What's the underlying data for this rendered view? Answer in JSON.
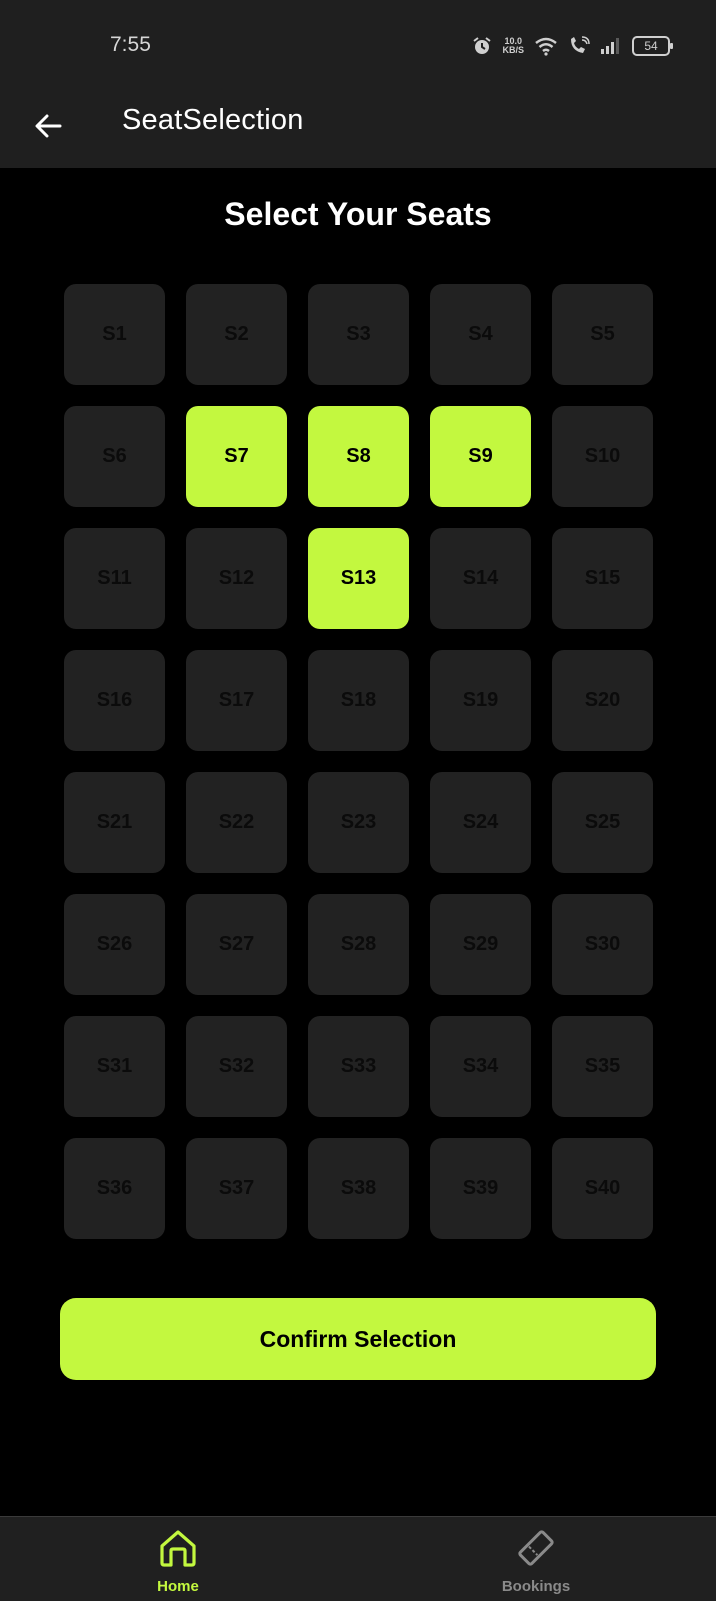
{
  "status_bar": {
    "time": "7:55",
    "net_speed_value": "10.0",
    "net_speed_unit": "KB/S",
    "battery": "54",
    "icons": [
      "alarm-icon",
      "wifi-icon",
      "wifi-call-icon",
      "signal-icon",
      "battery-icon"
    ]
  },
  "app_bar": {
    "title": "SeatSelection",
    "back_icon": "arrow-left-icon"
  },
  "main": {
    "heading": "Select Your Seats",
    "seats": [
      {
        "label": "S1",
        "selected": false
      },
      {
        "label": "S2",
        "selected": false
      },
      {
        "label": "S3",
        "selected": false
      },
      {
        "label": "S4",
        "selected": false
      },
      {
        "label": "S5",
        "selected": false
      },
      {
        "label": "S6",
        "selected": false
      },
      {
        "label": "S7",
        "selected": true
      },
      {
        "label": "S8",
        "selected": true
      },
      {
        "label": "S9",
        "selected": true
      },
      {
        "label": "S10",
        "selected": false
      },
      {
        "label": "S11",
        "selected": false
      },
      {
        "label": "S12",
        "selected": false
      },
      {
        "label": "S13",
        "selected": true
      },
      {
        "label": "S14",
        "selected": false
      },
      {
        "label": "S15",
        "selected": false
      },
      {
        "label": "S16",
        "selected": false
      },
      {
        "label": "S17",
        "selected": false
      },
      {
        "label": "S18",
        "selected": false
      },
      {
        "label": "S19",
        "selected": false
      },
      {
        "label": "S20",
        "selected": false
      },
      {
        "label": "S21",
        "selected": false
      },
      {
        "label": "S22",
        "selected": false
      },
      {
        "label": "S23",
        "selected": false
      },
      {
        "label": "S24",
        "selected": false
      },
      {
        "label": "S25",
        "selected": false
      },
      {
        "label": "S26",
        "selected": false
      },
      {
        "label": "S27",
        "selected": false
      },
      {
        "label": "S28",
        "selected": false
      },
      {
        "label": "S29",
        "selected": false
      },
      {
        "label": "S30",
        "selected": false
      },
      {
        "label": "S31",
        "selected": false
      },
      {
        "label": "S32",
        "selected": false
      },
      {
        "label": "S33",
        "selected": false
      },
      {
        "label": "S34",
        "selected": false
      },
      {
        "label": "S35",
        "selected": false
      },
      {
        "label": "S36",
        "selected": false
      },
      {
        "label": "S37",
        "selected": false
      },
      {
        "label": "S38",
        "selected": false
      },
      {
        "label": "S39",
        "selected": false
      },
      {
        "label": "S40",
        "selected": false
      }
    ],
    "confirm_label": "Confirm Selection"
  },
  "bottom_nav": {
    "items": [
      {
        "label": "Home",
        "icon": "home-icon",
        "active": true
      },
      {
        "label": "Bookings",
        "icon": "ticket-icon",
        "active": false
      }
    ]
  },
  "colors": {
    "accent": "#c3f83f",
    "background": "#000000",
    "surface": "#1f1f1f",
    "seat_available": "#222222",
    "nav_inactive": "#8a8a8a"
  }
}
